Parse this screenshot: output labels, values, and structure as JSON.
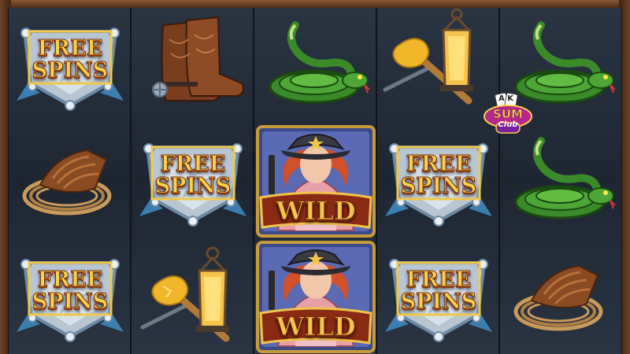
{
  "game": {
    "symbols": {
      "free_spins": {
        "line1": "FREE",
        "line2": "SPINS"
      },
      "wild": {
        "label": "WILD"
      }
    },
    "reels": [
      [
        "free-spins",
        "gloves-rope",
        "free-spins"
      ],
      [
        "cowboy-boots",
        "free-spins",
        "gold-pickaxe"
      ],
      [
        "rattlesnake",
        "wild",
        "wild"
      ],
      [
        "gold-lantern",
        "free-spins",
        "free-spins"
      ],
      [
        "rattlesnake",
        "rattlesnake",
        "gloves-rope"
      ]
    ],
    "logo": {
      "text": "SUM",
      "subtext": "Club",
      "cards": "A K"
    }
  },
  "colors": {
    "reel_bg": "#1e2632",
    "gold_text": "#f7d24a",
    "frame_wood": "#5a3620",
    "wild_badge": "#8a2a14"
  }
}
